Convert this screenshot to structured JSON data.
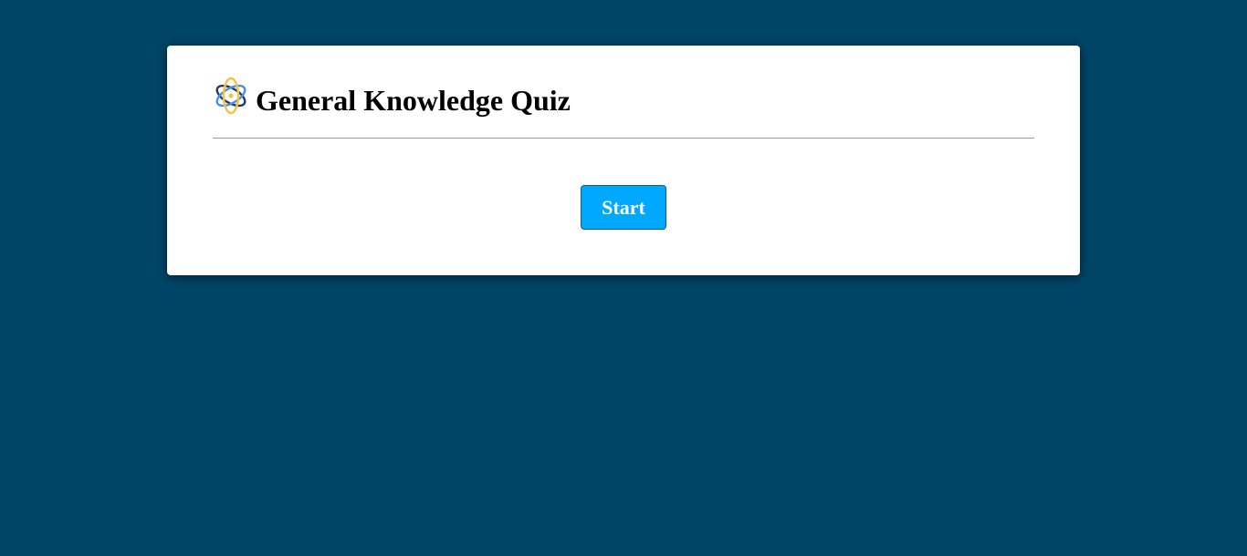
{
  "quiz": {
    "title": "General Knowledge Quiz",
    "logo_icon": "atom-icon",
    "start_label": "Start"
  },
  "colors": {
    "background": "#004466",
    "card": "#ffffff",
    "button": "#00a8ff",
    "logo_gold": "#f5c242",
    "logo_blue": "#4a90e2",
    "logo_navy": "#1f3a60"
  }
}
